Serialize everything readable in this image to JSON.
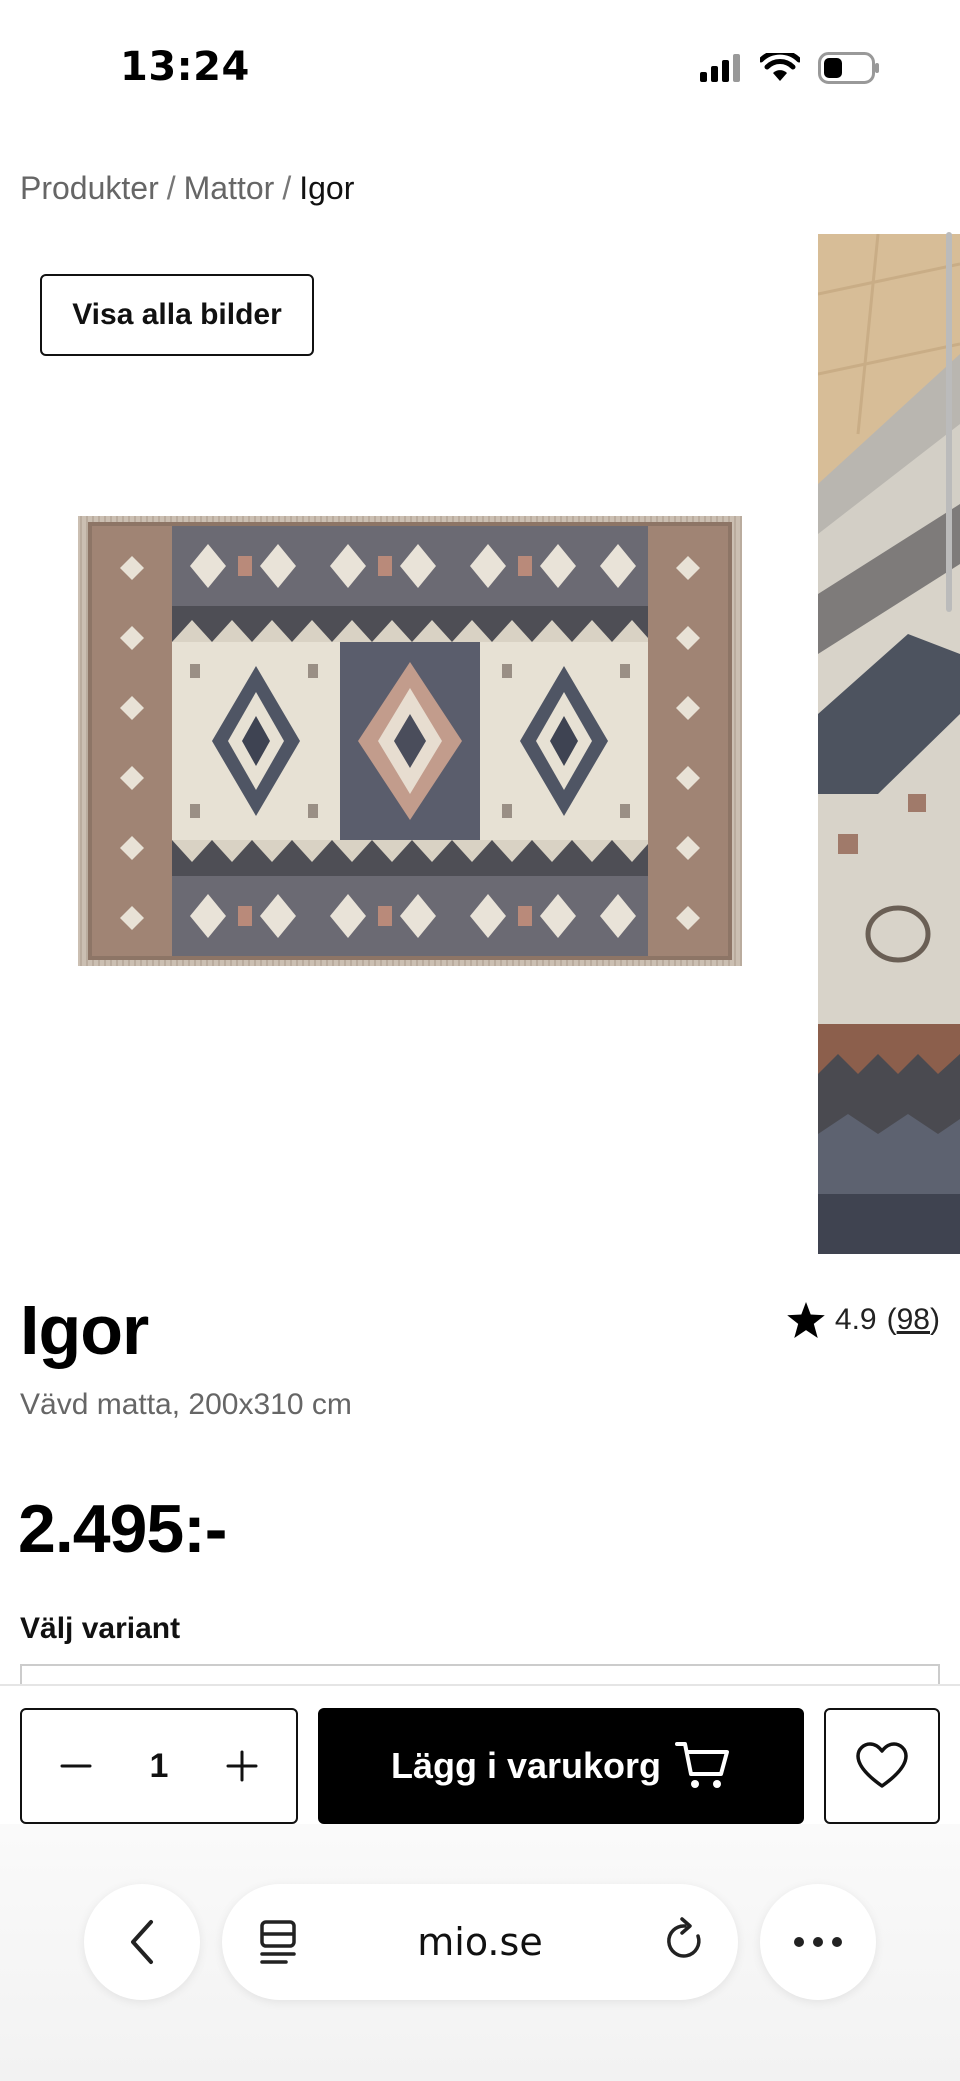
{
  "status_bar": {
    "time": "13:24"
  },
  "breadcrumb": {
    "items": [
      "Produkter",
      "Mattor"
    ],
    "separator": "/",
    "current": "Igor"
  },
  "gallery": {
    "view_all_label": "Visa alla bilder"
  },
  "product": {
    "title": "Igor",
    "subtitle": "Vävd matta, 200x310 cm",
    "price": "2.495:-",
    "rating": {
      "score": "4.9",
      "count": "98"
    }
  },
  "variant": {
    "label": "Välj variant"
  },
  "purchase": {
    "quantity": "1",
    "add_to_cart_label": "Lägg i varukorg"
  },
  "browser": {
    "url": "mio.se"
  },
  "icons": {
    "cellular": "signal-bars-icon",
    "wifi": "wifi-icon",
    "battery": "battery-icon",
    "star": "star-icon",
    "minus": "minus-icon",
    "plus": "plus-icon",
    "cart": "cart-icon",
    "heart": "heart-icon",
    "back": "chevron-left-icon",
    "tabs": "tabs-icon",
    "reload": "reload-icon",
    "more": "more-icon"
  },
  "colors": {
    "primary": "#000000",
    "muted_text": "#666666",
    "border": "#111111"
  }
}
